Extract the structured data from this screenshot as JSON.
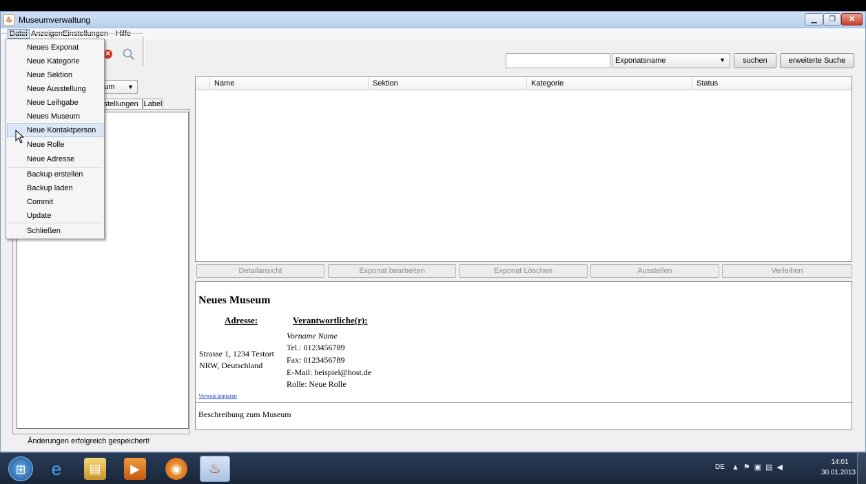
{
  "window": {
    "title": "Museumverwaltung"
  },
  "menubar": {
    "datei": "Datei",
    "anzeigen": "Anzeigen",
    "einstellungen": "Einstellungen",
    "hilfe": "Hilfe"
  },
  "datei_menu": {
    "items": [
      "Neues Exponat",
      "Neue Kategorie",
      "Neue Sektion",
      "Neue Ausstellung",
      "Neue Leihgabe",
      "Neues Museum",
      "Neue Kontaktperson",
      "Neue Rolle",
      "Neue Adresse",
      "Backup erstellen",
      "Backup laden",
      "Commit",
      "Update",
      "Schließen"
    ],
    "highlighted": "Neue Kontaktperson"
  },
  "search": {
    "value": "",
    "field_selected": "Exponatsname",
    "search_button": "suchen",
    "advanced_button": "erweiterte Suche"
  },
  "left_panel": {
    "combo_visible_text": "eum",
    "tab_exhibitions_partial": "sstellungen",
    "tab_label": "Label"
  },
  "table": {
    "columns": [
      "Name",
      "Sektion",
      "Kategorie",
      "Status"
    ]
  },
  "actions": {
    "detail": "Detailansicht",
    "edit": "Exponat bearbeiten",
    "delete": "Exponat Löschen",
    "exhibit": "Ausstellen",
    "lend": "Verleihen"
  },
  "detail": {
    "title": "Neues Museum",
    "address_heading": "Adresse:",
    "responsible_heading": "Verantwortliche(r):",
    "address_line1": "Strasse 1, 1234 Testort",
    "address_line2": "NRW, Deutschland",
    "contact_name": "Vorname Name",
    "contact_tel": "Tel.: 0123456789",
    "contact_fax": "Fax: 0123456789",
    "contact_email": "E-Mail: beispiel@host.de",
    "contact_role": "Rolle: Neue Rolle",
    "copy_link": "Verweis kopieren",
    "description": "Beschreibung zum Museum"
  },
  "status": {
    "message": "Änderungen erfolgreich gespeichert!"
  },
  "taskbar": {
    "language": "DE",
    "time": "14:01",
    "date": "30.01.2013"
  },
  "icons": [
    "java-icon",
    "delete-icon",
    "search-icon",
    "start-icon",
    "ie-icon",
    "explorer-icon",
    "media-player-icon",
    "firefox-icon",
    "java-task-icon",
    "mouse-cursor-icon"
  ]
}
